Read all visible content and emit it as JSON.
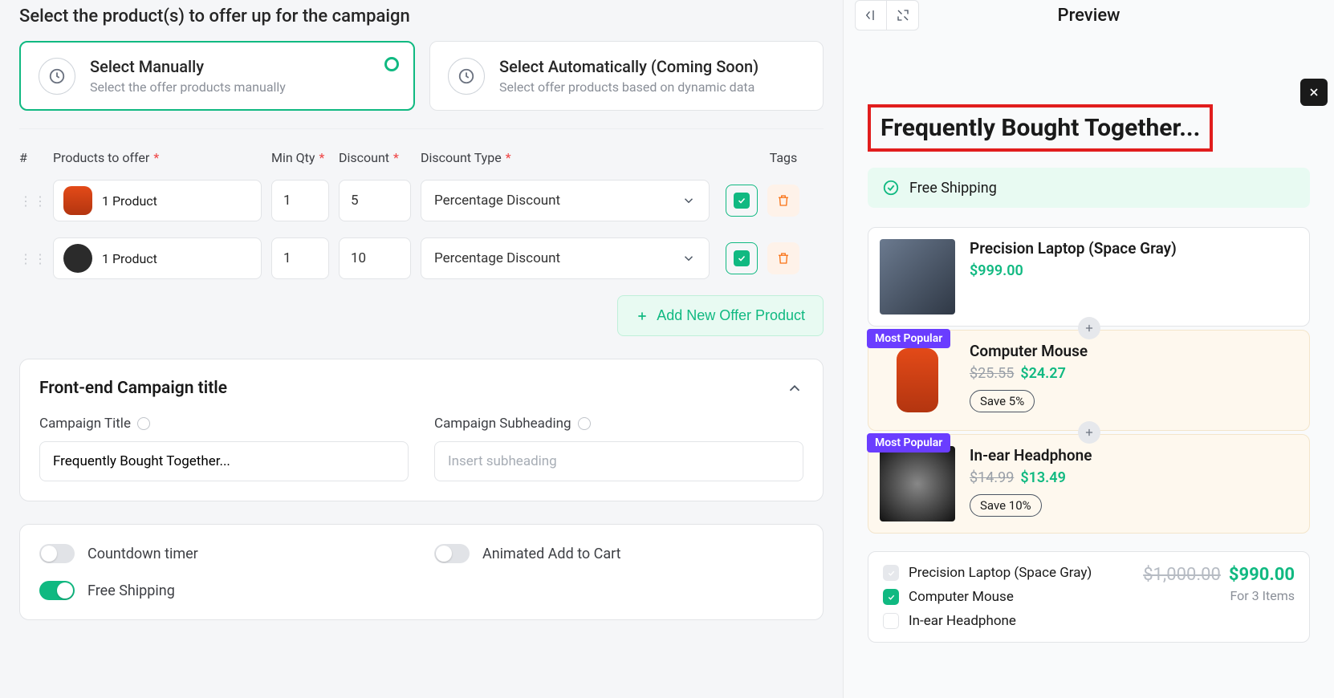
{
  "leftHeader": "Select the product(s) to offer up for the campaign",
  "cardManual": {
    "title": "Select Manually",
    "sub": "Select the offer products manually"
  },
  "cardAuto": {
    "title": "Select Automatically (Coming Soon)",
    "sub": "Select offer products based on dynamic data"
  },
  "tableHead": {
    "hash": "#",
    "products": "Products to offer",
    "min": "Min Qty",
    "disc": "Discount",
    "type": "Discount Type",
    "tags": "Tags"
  },
  "rows": [
    {
      "product": "1 Product",
      "min": "1",
      "disc": "5",
      "type": "Percentage Discount"
    },
    {
      "product": "1 Product",
      "min": "1",
      "disc": "10",
      "type": "Percentage Discount"
    }
  ],
  "addBtn": "Add New Offer Product",
  "panelTitle": "Front-end Campaign title",
  "fields": {
    "titleLabel": "Campaign Title",
    "titleValue": "Frequently Bought Together...",
    "subLabel": "Campaign Subheading",
    "subPlaceholder": "Insert subheading"
  },
  "toggles": {
    "countdown": "Countdown timer",
    "animated": "Animated Add to Cart",
    "ship": "Free Shipping"
  },
  "preview": {
    "title": "Preview",
    "fbt": "Frequently Bought Together...",
    "ship": "Free Shipping",
    "items": [
      {
        "name": "Precision Laptop (Space Gray)",
        "price": "$999.00"
      },
      {
        "name": "Computer Mouse",
        "old": "$25.55",
        "now": "$24.27",
        "save": "Save 5%",
        "popular": "Most Popular"
      },
      {
        "name": "In-ear Headphone",
        "old": "$14.99",
        "now": "$13.49",
        "save": "Save 10%",
        "popular": "Most Popular"
      }
    ],
    "summary": {
      "items": [
        "Precision Laptop (Space Gray)",
        "Computer Mouse",
        "In-ear Headphone"
      ],
      "old": "$1,000.00",
      "new": "$990.00",
      "for": "For 3 Items"
    }
  }
}
